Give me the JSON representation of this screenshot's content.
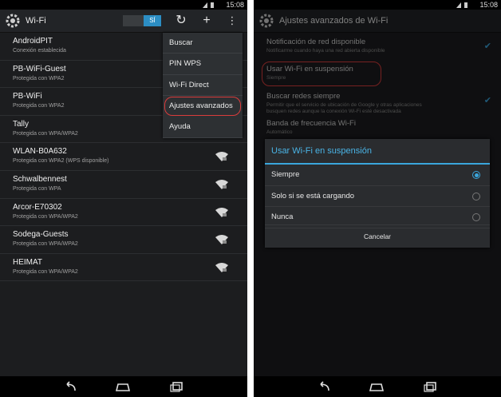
{
  "status": {
    "time": "15:08"
  },
  "left": {
    "title": "Wi-Fi",
    "toggle_label": "SÍ",
    "networks": [
      {
        "name": "AndroidPIT",
        "status": "Conexión establecida",
        "signal_icon": false
      },
      {
        "name": "PB-WiFi-Guest",
        "status": "Protegida con WPA2",
        "signal_icon": false
      },
      {
        "name": "PB-WiFi",
        "status": "Protegida con WPA2",
        "signal_icon": false
      },
      {
        "name": "Tally",
        "status": "Protegida con WPA/WPA2",
        "signal_icon": false
      },
      {
        "name": "WLAN-B0A632",
        "status": "Protegida con WPA2 (WPS disponible)",
        "signal_icon": true
      },
      {
        "name": "Schwalbennest",
        "status": "Protegida con WPA",
        "signal_icon": true
      },
      {
        "name": "Arcor-E70302",
        "status": "Protegida con WPA/WPA2",
        "signal_icon": true
      },
      {
        "name": "Sodega-Guests",
        "status": "Protegida con WPA/WPA2",
        "signal_icon": true
      },
      {
        "name": "HEIMAT",
        "status": "Protegida con WPA/WPA2",
        "signal_icon": true
      }
    ],
    "menu": [
      "Buscar",
      "PIN WPS",
      "Wi-Fi Direct",
      "Ajustes avanzados",
      "Ayuda"
    ]
  },
  "right": {
    "title": "Ajustes avanzados de Wi-Fi",
    "settings": [
      {
        "title": "Notificación de red disponible",
        "sub": "Notificarme cuando haya una red abierta disponible",
        "checked": true
      },
      {
        "title": "Usar Wi-Fi en suspensión",
        "sub": "Siempre",
        "checked": false
      },
      {
        "title": "Buscar redes siempre",
        "sub": "Permitir que el servicio de ubicación de Google y otras aplicaciones busquen redes aunque la conexión Wi-Fi esté desactivada",
        "checked": true
      },
      {
        "title": "Banda de frecuencia Wi-Fi",
        "sub": "Automático",
        "checked": false
      }
    ],
    "dialog": {
      "title": "Usar Wi-Fi en suspensión",
      "options": [
        "Siempre",
        "Solo si se está cargando",
        "Nunca"
      ],
      "selected": 0,
      "cancel": "Cancelar"
    }
  },
  "colors": {
    "accent": "#3aa6dc",
    "highlight": "#d93c3c"
  }
}
